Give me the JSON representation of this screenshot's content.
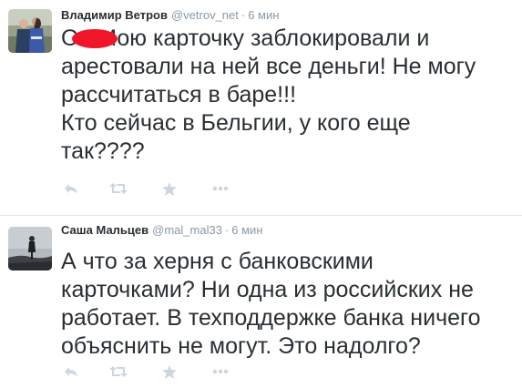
{
  "tweets": [
    {
      "author": {
        "fullname": "Владимир Ветров",
        "username": "@vetrov_net"
      },
      "time": "6 мин",
      "text": "О     ! Мою карточку заблокировали и\nарестовали на ней все деньги! Не могу\nрассчитаться в баре!!!\nКто сейчас в Бельгии, у кого еще\nтак????",
      "actions": [
        "reply-icon",
        "retweet-icon",
        "favorite-icon",
        "more-icon"
      ]
    },
    {
      "author": {
        "fullname": "Саша Мальцев",
        "username": "@mal_mal33"
      },
      "time": "6 мин",
      "text": "А что за херня с банковскими\nкарточками? Ни одна из российских не\nработает. В техподдержке банка ничего\nобъяснить не могут. Это надолго?",
      "actions": [
        "reply-icon",
        "retweet-icon",
        "favorite-icon",
        "more-icon"
      ]
    }
  ],
  "separator": "·",
  "colors": {
    "text": "#292f33",
    "meta": "#8899a6",
    "action_icon": "#ccd6dd",
    "redaction": "#f0162a",
    "divider": "#e1e8ed"
  }
}
